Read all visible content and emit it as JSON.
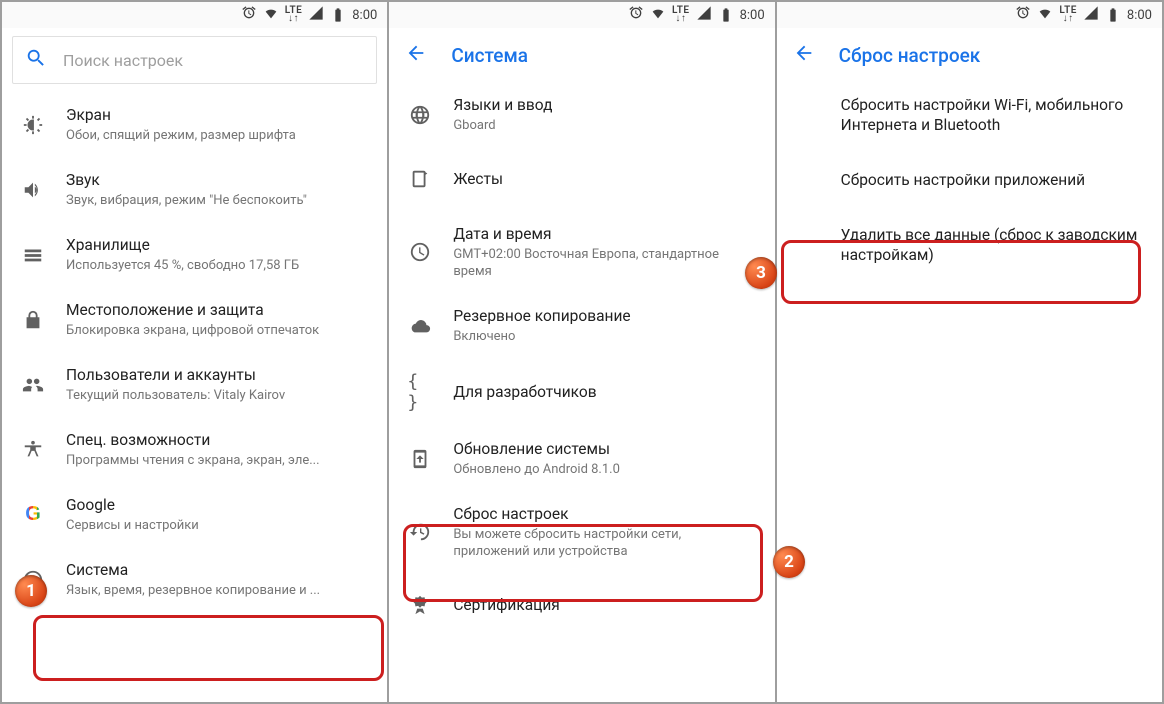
{
  "status": {
    "time": "8:00",
    "net_label": "LTE"
  },
  "p1": {
    "search_placeholder": "Поиск настроек",
    "items": [
      {
        "title": "Экран",
        "sub": "Обои, спящий режим, размер шрифта"
      },
      {
        "title": "Звук",
        "sub": "Звук, вибрация, режим \"Не беспокоить\""
      },
      {
        "title": "Хранилище",
        "sub": "Используется 45 %, свободно 17,58 ГБ"
      },
      {
        "title": "Местоположение и защита",
        "sub": "Блокировка экрана, цифровой отпечаток"
      },
      {
        "title": "Пользователи и аккаунты",
        "sub": "Текущий пользователь: Vitaly Kairov"
      },
      {
        "title": "Спец. возможности",
        "sub": "Программы чтения с экрана, экран, эле..."
      },
      {
        "title": "Google",
        "sub": "Сервисы и настройки"
      },
      {
        "title": "Система",
        "sub": "Язык, время, резервное копирование и ..."
      }
    ]
  },
  "p2": {
    "header": "Система",
    "items": [
      {
        "title": "Языки и ввод",
        "sub": "Gboard"
      },
      {
        "title": "Жесты",
        "sub": ""
      },
      {
        "title": "Дата и время",
        "sub": "GMT+02:00 Восточная Европа, стандартное время"
      },
      {
        "title": "Резервное копирование",
        "sub": "Включено"
      },
      {
        "title": "Для разработчиков",
        "sub": ""
      },
      {
        "title": "Обновление системы",
        "sub": "Обновлено до Android 8.1.0"
      },
      {
        "title": "Сброс настроек",
        "sub": "Вы можете сбросить настройки сети, приложений или устройства"
      },
      {
        "title": "Сертификация",
        "sub": ""
      }
    ]
  },
  "p3": {
    "header": "Сброс настроек",
    "items": [
      {
        "title": "Сбросить настройки Wi-Fi, мобильного Интернета и Bluetooth"
      },
      {
        "title": "Сбросить настройки приложений"
      },
      {
        "title": "Удалить все данные (сброс к заводским настройкам)"
      }
    ]
  },
  "badges": {
    "b1": "1",
    "b2": "2",
    "b3": "3"
  }
}
